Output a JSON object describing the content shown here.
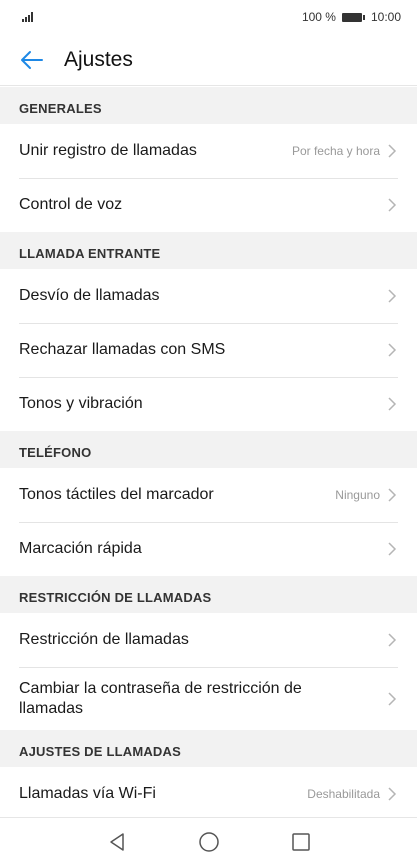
{
  "status_bar": {
    "battery_text": "100 %",
    "time": "10:00"
  },
  "header": {
    "title": "Ajustes"
  },
  "sections": [
    {
      "title": "GENERALES",
      "items": [
        {
          "label": "Unir registro de llamadas",
          "value": "Por fecha y hora"
        },
        {
          "label": "Control de voz"
        }
      ]
    },
    {
      "title": "LLAMADA ENTRANTE",
      "items": [
        {
          "label": "Desvío de llamadas"
        },
        {
          "label": "Rechazar llamadas con SMS"
        },
        {
          "label": "Tonos y vibración"
        }
      ]
    },
    {
      "title": "TELÉFONO",
      "items": [
        {
          "label": "Tonos táctiles del marcador",
          "value": "Ninguno"
        },
        {
          "label": "Marcación rápida"
        }
      ]
    },
    {
      "title": "RESTRICCIÓN DE LLAMADAS",
      "items": [
        {
          "label": "Restricción de llamadas"
        },
        {
          "label": "Cambiar la contraseña de restricción de llamadas"
        }
      ]
    },
    {
      "title": "AJUSTES DE LLAMADAS",
      "items": [
        {
          "label": "Llamadas vía Wi-Fi",
          "value": "Deshabilitada"
        }
      ]
    }
  ],
  "icons": {
    "back": "arrow-left-icon",
    "chevron": "chevron-right-icon",
    "nav_back": "triangle-back-icon",
    "nav_home": "circle-home-icon",
    "nav_recent": "square-recent-icon"
  },
  "colors": {
    "accent": "#1e88e5",
    "section_bg": "#f2f2f2",
    "value_text": "#999999"
  }
}
